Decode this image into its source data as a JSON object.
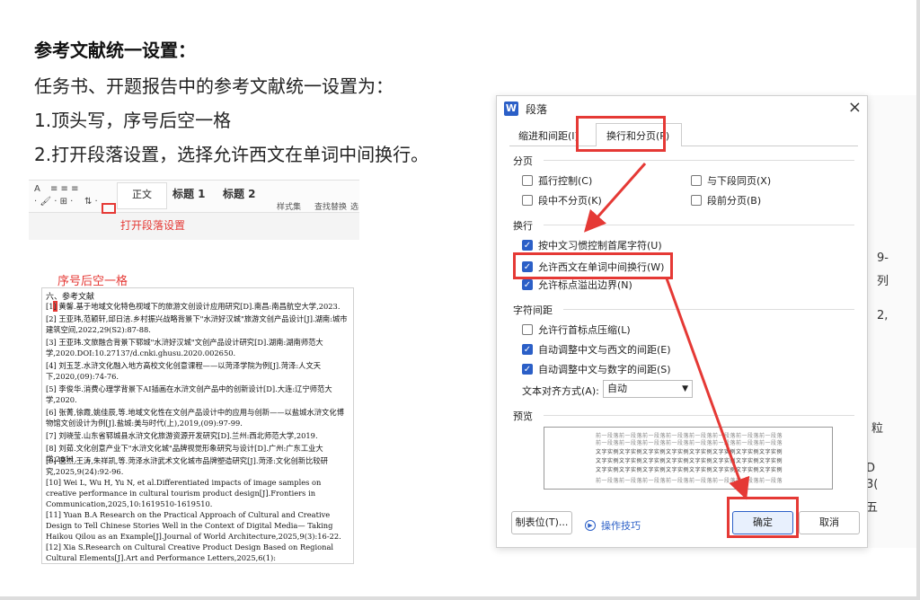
{
  "slide": {
    "heading": "参考文献统一设置：",
    "line1": "任务书、开题报告中的参考文献统一设置为：",
    "line2": "1.顶头写，序号后空一格",
    "line3": "2.打开段落设置，选择允许西文在单词中间换行。"
  },
  "toolbar": {
    "items": [
      "A",
      "Ξ",
      "正文",
      "标题 1",
      "标题 2",
      "样式集",
      "查找替换",
      "选"
    ],
    "annotation": "打开段落设置"
  },
  "reference": {
    "annotation": "序号后空一格",
    "title": "六、参考文献",
    "items": [
      "[1] 黄馨.基于地域文化特色视域下的旅游文创设计应用研究[D].南昌:南昌航空大学,2023.",
      "[2] 王亚玮,范颖轩,邱日洁.乡村振兴战略背景下\"水浒好汉城\"旅游文创产品设计[J].湖南:城市建筑空间,2022,29(S2):87-88.",
      "[3] 王亚玮.文旅融合背景下郓城\"水浒好汉城\"文创产品设计研究[D].湖南:湖南师范大学,2020.DOI:10.27137/d.cnki.ghusu.2020.002650.",
      "[4] 刘玉芝.水浒文化融入地方高校文化创意课程——以菏泽学院为例[J].菏泽:人文天下,2020,(09):74-76.",
      "[5] 李俊华.消费心理学背景下AI插画在水浒文创产品中的创新设计[D].大连:辽宁师范大学,2020.",
      "[6] 张菁,徐霞,姚佳辰,等.地域文化性在文创产品设计中的应用与创新——以盐城水浒文化博物馆文创设计为例[J].盐城:美与时代(上),2019,(09):97-99.",
      "[7] 刘晓莹.山东省郓城县水浒文化旅游资源开发研究[D].兰州:西北师范大学,2019.",
      "[8] 刘茹.文化创意产业下\"水浒文化城\"品牌视觉形象研究与设计[D].广州:广东工业大学,2011.",
      "[9] 唐杰,王涛,朱祥凯,等.菏泽水浒武术文化城市品牌塑造研究[J].菏泽:文化创新比较研究,2025,9(24):92-96.",
      "[10] Wei L, Wu H, Yu N, et al.Differentiated impacts of image samples on creative performance in cultural tourism product design[J].Frontiers in Communication,2025,10:1619510-1619510.",
      "[11] Yuan B.A Research on the Practical Approach of Cultural and Creative Design to Tell Chinese Stories Well in the Context of Digital Media— Taking Haikou Qilou as an Example[J].Journal of World Architecture,2025,9(3):16-22.",
      "[12] Xia S.Research on Cultural Creative Product Design Based on Regional Cultural Elements[J].Art and Performance Letters,2025,6(1):"
    ]
  },
  "dialog": {
    "title": "段落",
    "tab1": "缩进和间距(I)",
    "tab2": "换行和分页(P)",
    "sec_pagination": "分页",
    "widow": "孤行控制(C)",
    "keep_next": "与下段同页(X)",
    "keep_lines": "段中不分页(K)",
    "page_break": "段前分页(B)",
    "sec_linebreak": "换行",
    "cjk_rules": "按中文习惯控制首尾字符(U)",
    "allow_latin": "允许西文在单词中间换行(W)",
    "punct_overflow": "允许标点溢出边界(N)",
    "sec_spacing": "字符间距",
    "compress": "允许行首标点压缩(L)",
    "auto_latin": "自动调整中文与西文的间距(E)",
    "auto_num": "自动调整中文与数字的间距(S)",
    "align_label": "文本对齐方式(A):",
    "align_value": "自动",
    "sec_preview": "预览",
    "preview_gray": "前一段落前一段落前一段落前一段落前一段落前一段落前一段落前一段落",
    "preview_text": "文字实例文字实例文字实例文字实例文字实例文字实例文字实例文字实例",
    "tabs_btn": "制表位(T)...",
    "tips": "操作技巧",
    "ok": "确定",
    "cancel": "取消"
  },
  "bg": {
    "c1": "9-",
    "c2": "列",
    "c3": "2,",
    "c4": "粒",
    "c5": "D",
    "c6": "3(",
    "c7": "五"
  },
  "colors": {
    "highlight": "#e53935",
    "accent": "#2b5fc7"
  }
}
